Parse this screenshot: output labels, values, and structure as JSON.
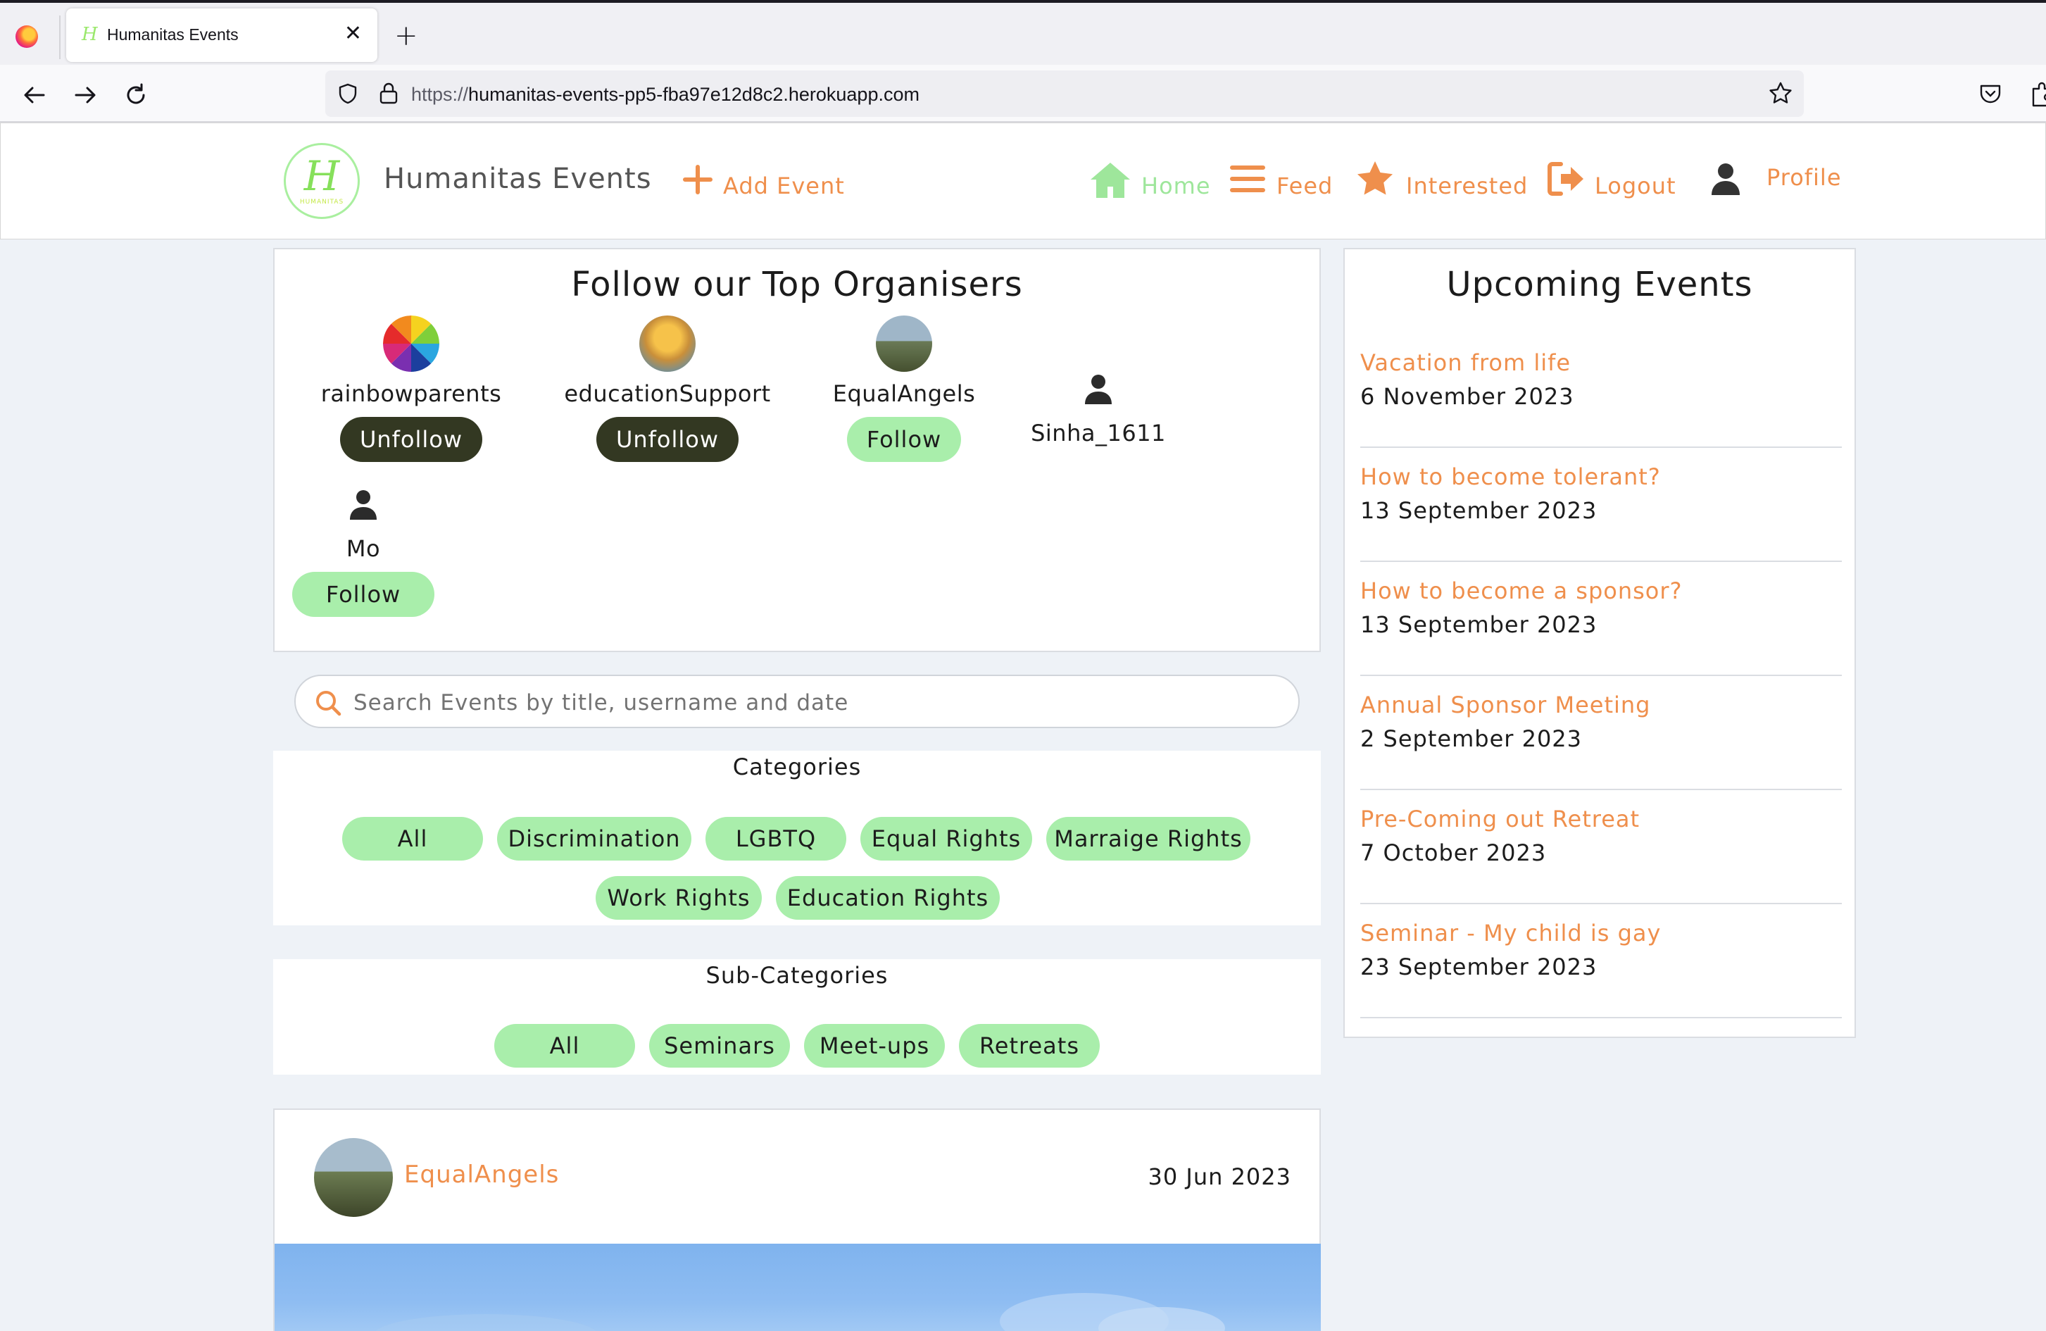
{
  "browser": {
    "tab_title": "Humanitas Events",
    "tab_close": "✕",
    "new_tab": "+",
    "url_protocol": "https://",
    "url_host": "humanitas-events-pp5-fba97e12d8c2.herokuapp.com"
  },
  "header": {
    "brand": "Humanitas Events",
    "logo_letter": "H",
    "logo_sub": "HUMANITAS",
    "nav": {
      "add_event": "Add Event",
      "home": "Home",
      "feed": "Feed",
      "interested": "Interested",
      "logout": "Logout",
      "profile": "Profile"
    },
    "colors": {
      "accent": "#ef8f4c",
      "active": "#9ee69b"
    }
  },
  "organisers": {
    "title": "Follow our Top Organisers",
    "items": [
      {
        "name": "rainbowparents",
        "button": "Unfollow"
      },
      {
        "name": "educationSupport",
        "button": "Unfollow"
      },
      {
        "name": "EqualAngels",
        "button": "Follow"
      },
      {
        "name": "Sinha_1611"
      },
      {
        "name": "Mo",
        "button": "Follow"
      }
    ]
  },
  "search": {
    "placeholder": "Search Events by title, username and date"
  },
  "categories": {
    "title": "Categories",
    "chips": [
      "All",
      "Discrimination",
      "LGBTQ",
      "Equal Rights",
      "Marraige Rights",
      "Work Rights",
      "Education Rights"
    ]
  },
  "subcategories": {
    "title": "Sub-Categories",
    "chips": [
      "All",
      "Seminars",
      "Meet-ups",
      "Retreats"
    ]
  },
  "post": {
    "username": "EqualAngels",
    "date": "30 Jun 2023"
  },
  "upcoming": {
    "title": "Upcoming Events",
    "events": [
      {
        "title": "Vacation from life",
        "date": "6 November 2023"
      },
      {
        "title": "How to become tolerant?",
        "date": "13 September 2023"
      },
      {
        "title": "How to become a sponsor?",
        "date": "13 September 2023"
      },
      {
        "title": "Annual Sponsor Meeting",
        "date": "2 September 2023"
      },
      {
        "title": "Pre-Coming out Retreat",
        "date": "7 October 2023"
      },
      {
        "title": "Seminar - My child is gay",
        "date": "23 September 2023"
      }
    ]
  }
}
